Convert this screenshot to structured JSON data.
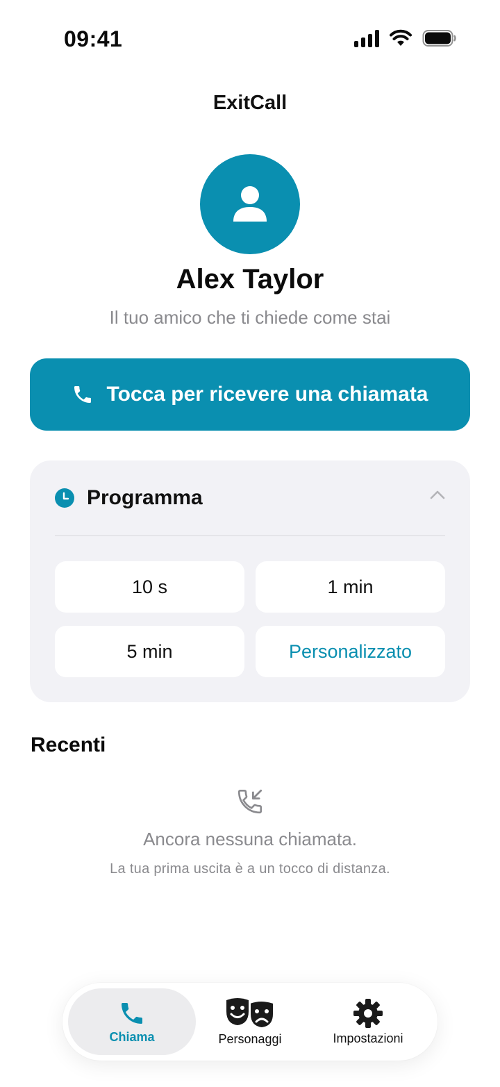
{
  "status_bar": {
    "time": "09:41"
  },
  "app": {
    "title": "ExitCall"
  },
  "contact": {
    "name": "Alex Taylor",
    "description": "Il tuo amico che ti chiede come stai",
    "avatar_icon": "person-icon"
  },
  "call_button": {
    "label": "Tocca per ricevere una chiamata",
    "icon": "phone-icon"
  },
  "schedule": {
    "title": "Programma",
    "expanded": true,
    "options": [
      {
        "label": "10 s"
      },
      {
        "label": "1 min"
      },
      {
        "label": "5 min"
      },
      {
        "label": "Personalizzato"
      }
    ]
  },
  "recents": {
    "title": "Recenti",
    "empty_icon": "incoming-call-icon",
    "empty_title": "Ancora nessuna chiamata.",
    "empty_subtitle": "La tua prima uscita è a un tocco di distanza."
  },
  "tab_bar": {
    "tabs": [
      {
        "label": "Chiama",
        "icon": "phone-icon",
        "active": true
      },
      {
        "label": "Personaggi",
        "icon": "theater-masks-icon",
        "active": false
      },
      {
        "label": "Impostazioni",
        "icon": "gear-icon",
        "active": false
      }
    ]
  },
  "colors": {
    "accent": "#0a8fb0",
    "card_bg": "#f2f2f6",
    "muted_text": "#8a8a8e"
  }
}
